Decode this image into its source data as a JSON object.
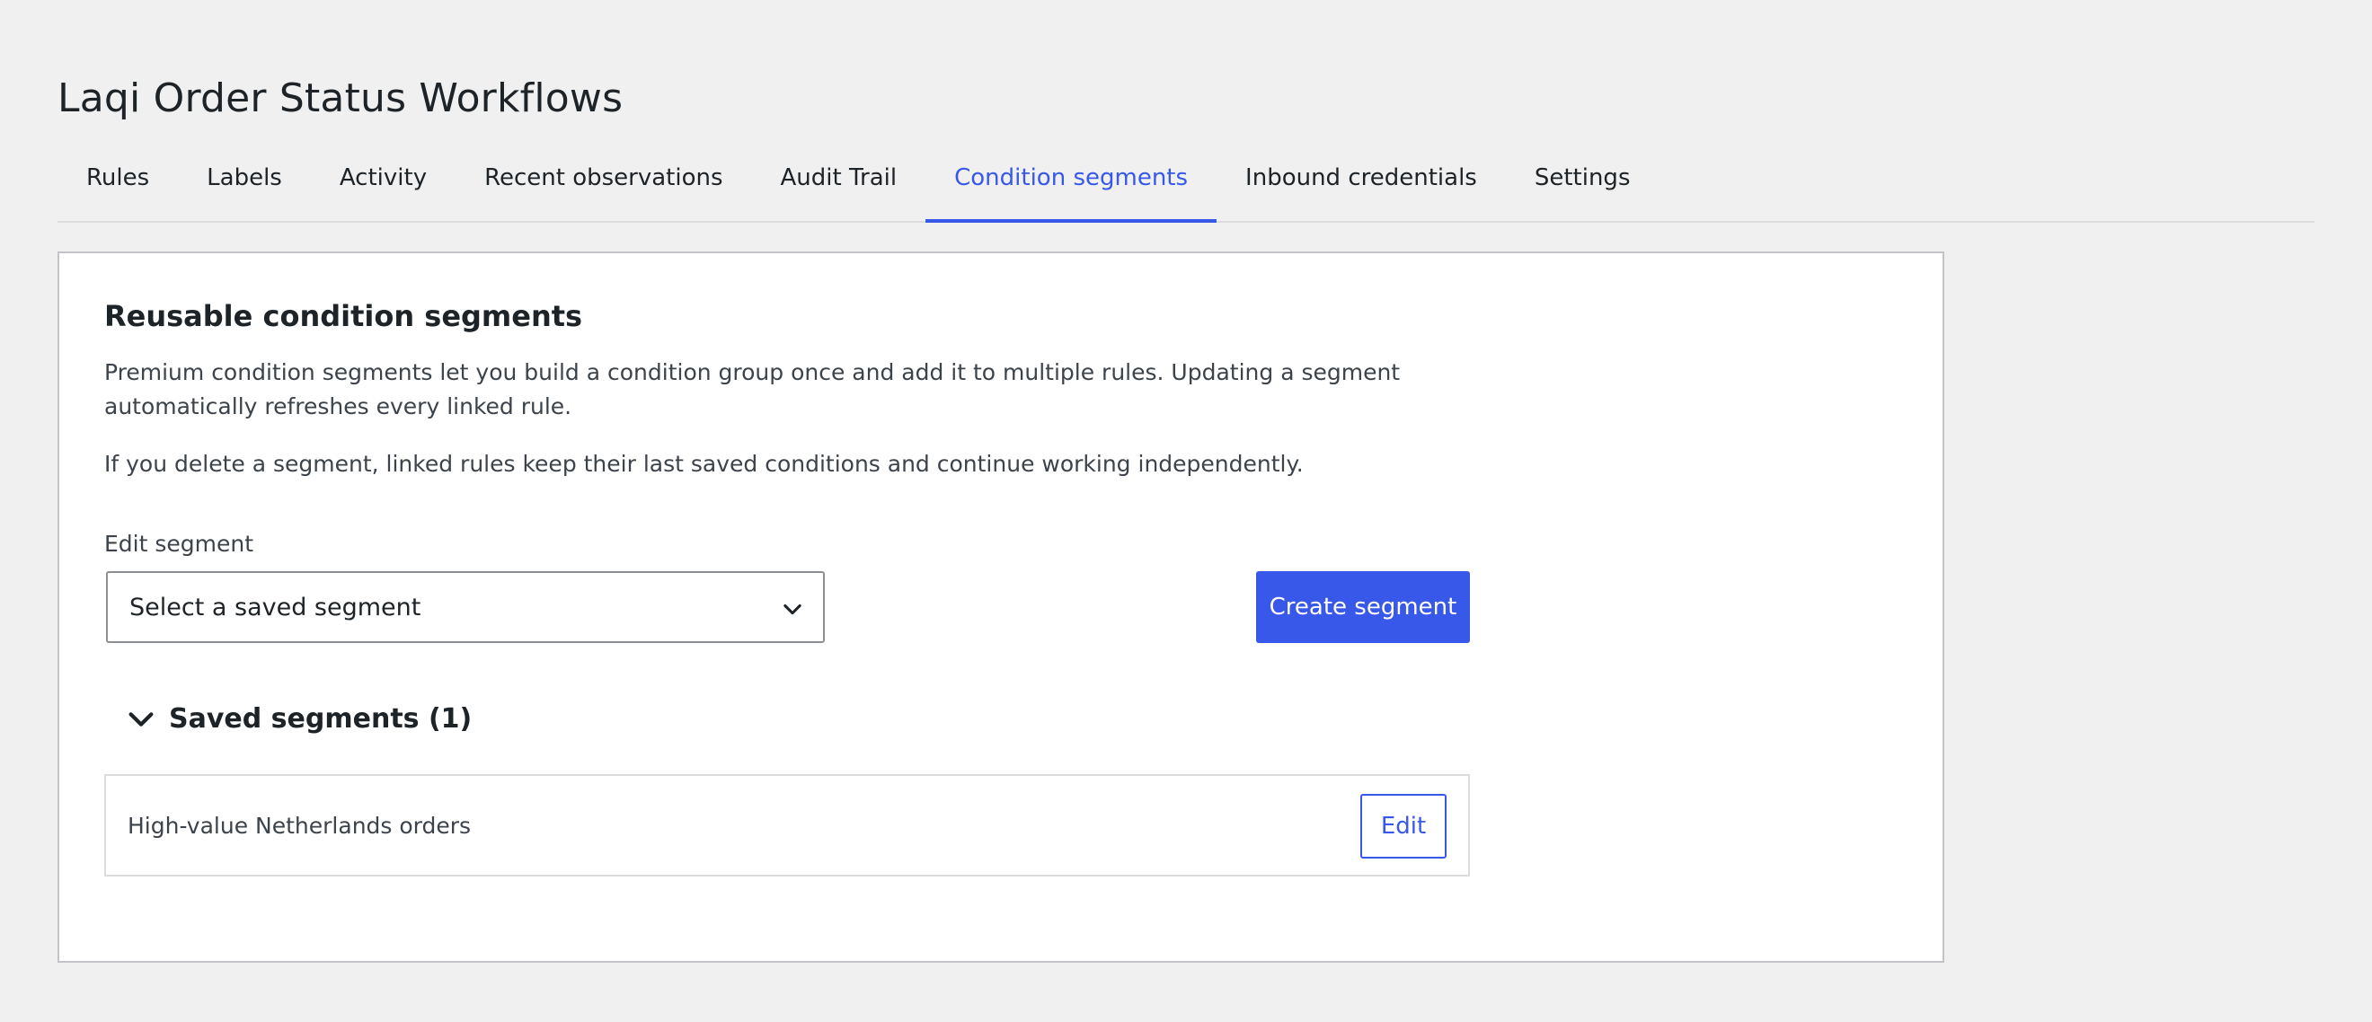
{
  "page": {
    "title": "Laqi Order Status Workflows"
  },
  "tabs": [
    {
      "label": "Rules"
    },
    {
      "label": "Labels"
    },
    {
      "label": "Activity"
    },
    {
      "label": "Recent observations"
    },
    {
      "label": "Audit Trail"
    },
    {
      "label": "Condition segments",
      "active": true
    },
    {
      "label": "Inbound credentials"
    },
    {
      "label": "Settings"
    }
  ],
  "card": {
    "title": "Reusable condition segments",
    "description": "Premium condition segments let you build a condition group once and add it to multiple rules. Updating a segment automatically refreshes every linked rule.",
    "note": "If you delete a segment, linked rules keep their last saved conditions and continue working independently.",
    "edit_label": "Edit segment",
    "select_placeholder": "Select a saved segment",
    "create_button": "Create segment",
    "saved_heading": "Saved segments (1)",
    "segments": [
      {
        "name": "High-value Netherlands orders",
        "edit_label": "Edit"
      }
    ]
  },
  "colors": {
    "accent": "#3858e9",
    "background": "#f0f0f1",
    "card": "#ffffff",
    "text": "#1d2327"
  },
  "icons": {
    "select_chevron": "chevron-down-icon",
    "saved_toggle": "chevron-down-icon"
  }
}
